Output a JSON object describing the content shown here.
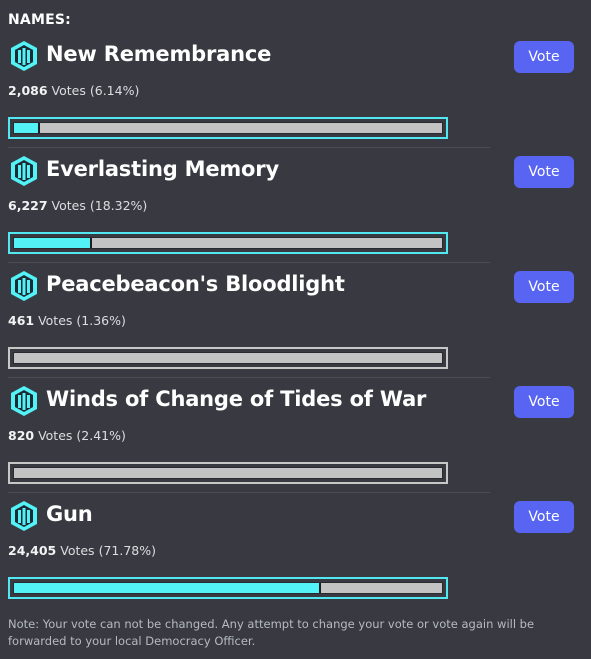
{
  "poll": {
    "heading": "NAMES:",
    "vote_label": "Vote",
    "votes_word": "Votes",
    "options": [
      {
        "name": "New Remembrance",
        "votes": "2,086",
        "percent_text": "(6.14%)",
        "percent": 6.14,
        "highlighted": true
      },
      {
        "name": "Everlasting Memory",
        "votes": "6,227",
        "percent_text": "(18.32%)",
        "percent": 18.32,
        "highlighted": true
      },
      {
        "name": "Peacebeacon's Bloodlight",
        "votes": "461",
        "percent_text": "(1.36%)",
        "percent": 1.36,
        "highlighted": false
      },
      {
        "name": "Winds of Change of Tides of War",
        "votes": "820",
        "percent_text": "(2.41%)",
        "percent": 2.41,
        "highlighted": false
      },
      {
        "name": "Gun",
        "votes": "24,405",
        "percent_text": "(71.78%)",
        "percent": 71.78,
        "highlighted": true
      }
    ],
    "note": "Note: Your vote can not be changed. Any attempt to change your vote or vote again will be forwarded to your local Democracy Officer."
  },
  "icons": {
    "option_icon": "helldivers-emblem-icon"
  },
  "colors": {
    "background": "#393a41",
    "accent": "#52f2f6",
    "button": "#5865f2",
    "track": "#c3c3c3"
  }
}
